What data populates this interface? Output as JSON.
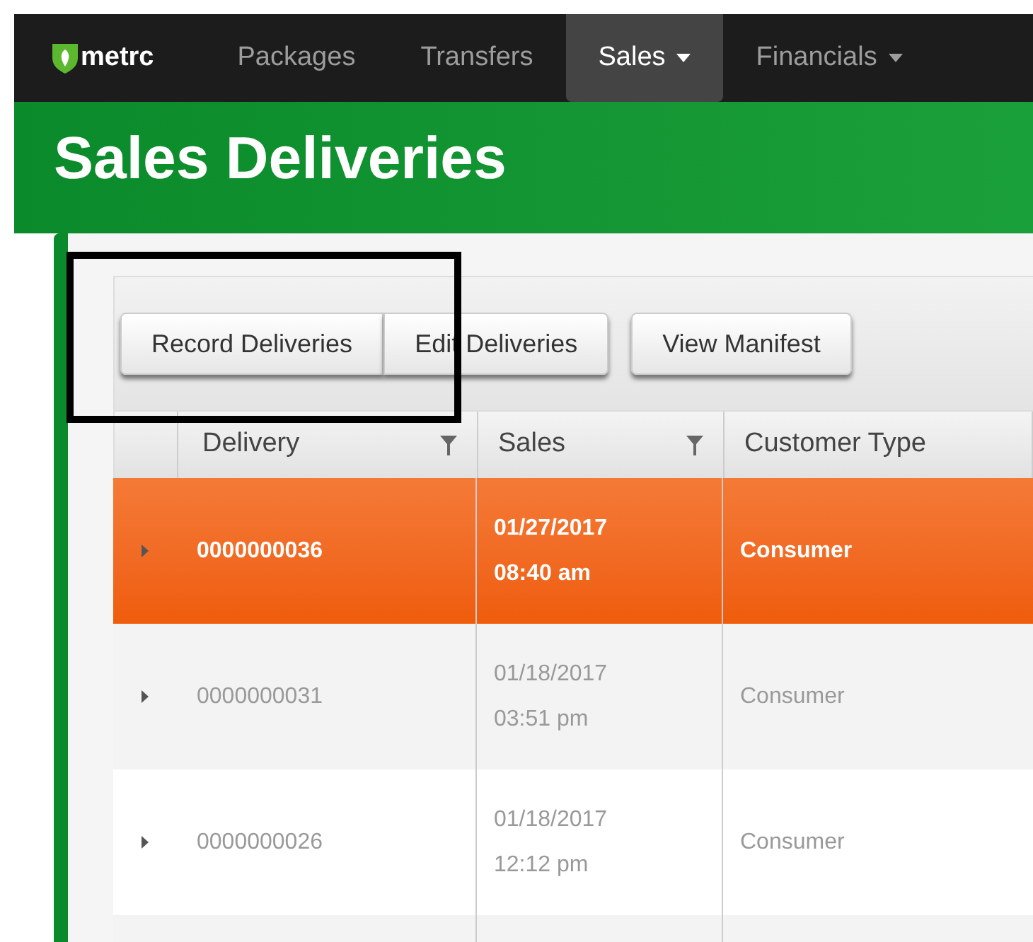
{
  "navbar": {
    "logo": "metrc",
    "items": [
      {
        "label": "Packages",
        "selected": false,
        "dropdown": false
      },
      {
        "label": "Transfers",
        "selected": false,
        "dropdown": false
      },
      {
        "label": "Sales",
        "selected": true,
        "dropdown": true
      },
      {
        "label": "Financials",
        "selected": false,
        "dropdown": true
      }
    ]
  },
  "page_title": "Sales Deliveries",
  "toolbar": {
    "button_groups": [
      [
        "Record Deliveries",
        "Edit Deliveries"
      ],
      [
        "View Manifest"
      ]
    ]
  },
  "table": {
    "columns": [
      {
        "label": "Delivery",
        "filter": true
      },
      {
        "label": "Sales",
        "filter": true
      },
      {
        "label": "Customer Type",
        "filter": false
      }
    ],
    "rows": [
      {
        "delivery": "0000000036",
        "date": "01/27/2017",
        "time": "08:40 am",
        "customer_type": "Consumer",
        "selected": true
      },
      {
        "delivery": "0000000031",
        "date": "01/18/2017",
        "time": "03:51 pm",
        "customer_type": "Consumer",
        "selected": false
      },
      {
        "delivery": "0000000026",
        "date": "01/18/2017",
        "time": "12:12 pm",
        "customer_type": "Consumer",
        "selected": false
      }
    ]
  }
}
